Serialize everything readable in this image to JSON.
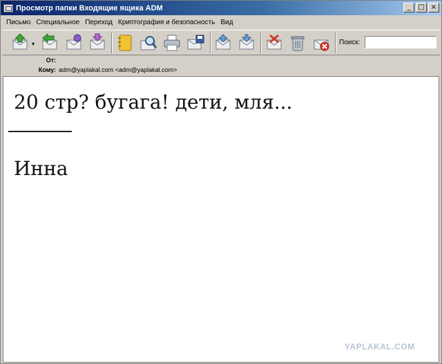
{
  "window": {
    "title": "Просмотр папки Входящие ящика ADM",
    "controls": {
      "minimize": "_",
      "maximize": "□",
      "close": "×"
    }
  },
  "menu": [
    "Письмо",
    "Специальное",
    "Переход",
    "Криптография и безопасность",
    "Вид"
  ],
  "toolbar": {
    "buttons": [
      "get-mail",
      "reply",
      "reply-all",
      "forward",
      "address-book",
      "find",
      "print",
      "save",
      "prev-message",
      "next-message",
      "mark",
      "delete",
      "junk"
    ],
    "dropdown_glyph": "▾",
    "search_label": "Поиск:",
    "search_value": ""
  },
  "headers": {
    "from_label": "От:",
    "from_value": "",
    "to_label": "Кому:",
    "to_value": "adm@yaplakal.com <adm@yaplakal.com>"
  },
  "message": {
    "line1": "20 стр? бугага! дети, мля...",
    "signature": "Инна"
  },
  "watermark": "YAPLAKAL.COM",
  "colors": {
    "titlebar": "#0a246a",
    "chrome": "#d4d0c8",
    "icon_green": "#3da83a",
    "icon_yellow": "#f1c232"
  }
}
